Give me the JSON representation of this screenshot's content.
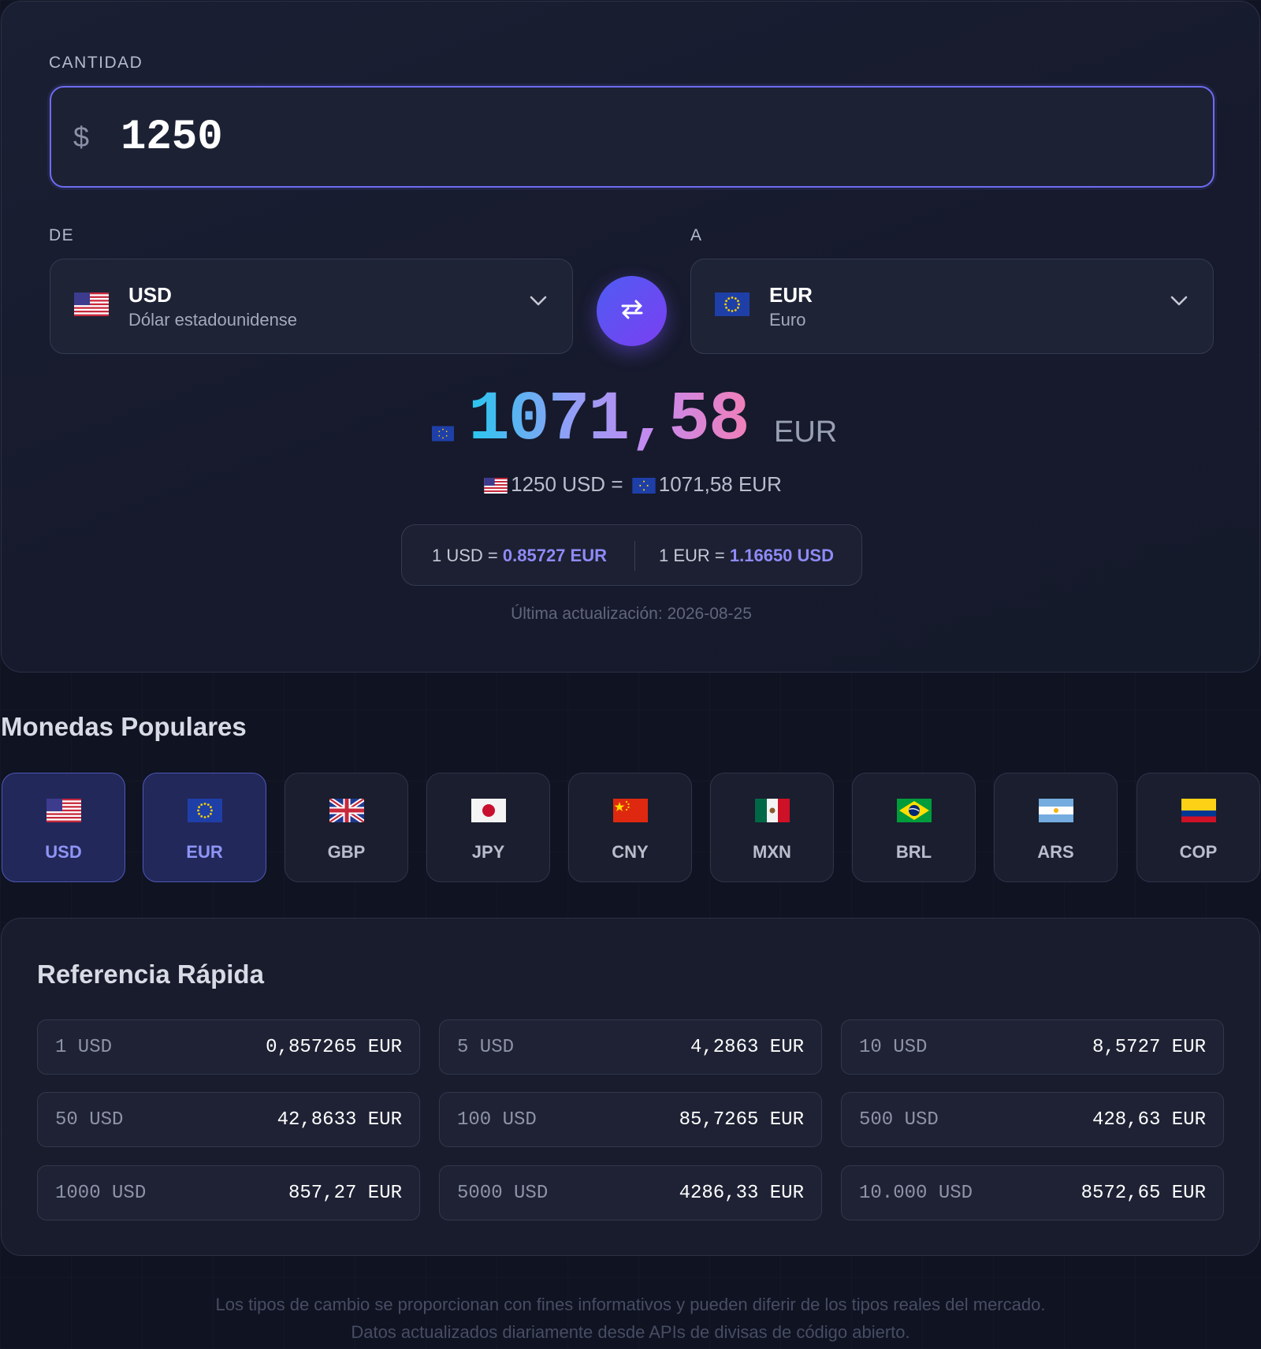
{
  "converter": {
    "amount_label": "CANTIDAD",
    "amount_symbol": "$",
    "amount_value": "1250",
    "from_label": "DE",
    "to_label": "A",
    "from": {
      "code": "USD",
      "name": "Dólar estadounidense",
      "flag_icon": "us-flag-icon"
    },
    "to": {
      "code": "EUR",
      "name": "Euro",
      "flag_icon": "eu-flag-icon"
    },
    "swap_icon": "swap-arrows-icon",
    "result_value": "1071,58",
    "result_unit": "EUR",
    "equation_left": "1250 USD",
    "equation_eq": "=",
    "equation_right": "1071,58 EUR",
    "rate1_prefix": "1 USD =",
    "rate1_value": "0.85727 EUR",
    "rate2_prefix": "1 EUR =",
    "rate2_value": "1.16650 USD",
    "updated": "Última actualización: 2026-08-25"
  },
  "popular": {
    "title": "Monedas Populares",
    "items": [
      {
        "code": "USD",
        "flag_icon": "us-flag-icon",
        "active": true
      },
      {
        "code": "EUR",
        "flag_icon": "eu-flag-icon",
        "active": true
      },
      {
        "code": "GBP",
        "flag_icon": "uk-flag-icon",
        "active": false
      },
      {
        "code": "JPY",
        "flag_icon": "japan-flag-icon",
        "active": false
      },
      {
        "code": "CNY",
        "flag_icon": "china-flag-icon",
        "active": false
      },
      {
        "code": "MXN",
        "flag_icon": "mexico-flag-icon",
        "active": false
      },
      {
        "code": "BRL",
        "flag_icon": "brazil-flag-icon",
        "active": false
      },
      {
        "code": "ARS",
        "flag_icon": "argentina-flag-icon",
        "active": false
      },
      {
        "code": "COP",
        "flag_icon": "colombia-flag-icon",
        "active": false
      }
    ]
  },
  "reference": {
    "title": "Referencia Rápida",
    "rows": [
      {
        "from": "1 USD",
        "to": "0,857265 EUR"
      },
      {
        "from": "5 USD",
        "to": "4,2863 EUR"
      },
      {
        "from": "10 USD",
        "to": "8,5727 EUR"
      },
      {
        "from": "50 USD",
        "to": "42,8633 EUR"
      },
      {
        "from": "100 USD",
        "to": "85,7265 EUR"
      },
      {
        "from": "500 USD",
        "to": "428,63 EUR"
      },
      {
        "from": "1000 USD",
        "to": "857,27 EUR"
      },
      {
        "from": "5000 USD",
        "to": "4286,33 EUR"
      },
      {
        "from": "10.000 USD",
        "to": "8572,65 EUR"
      }
    ]
  },
  "disclaimer": "Los tipos de cambio se proporcionan con fines informativos y pueden diferir de los tipos reales del mercado. Datos actualizados diariamente desde APIs de divisas de código abierto.",
  "colors": {
    "accent": "#6e6cf2",
    "swap_gradient_start": "#4f5cf2",
    "swap_gradient_end": "#7b3ff2",
    "rate_highlight": "#8f8af7",
    "active_chip_bg": "#22285a"
  }
}
